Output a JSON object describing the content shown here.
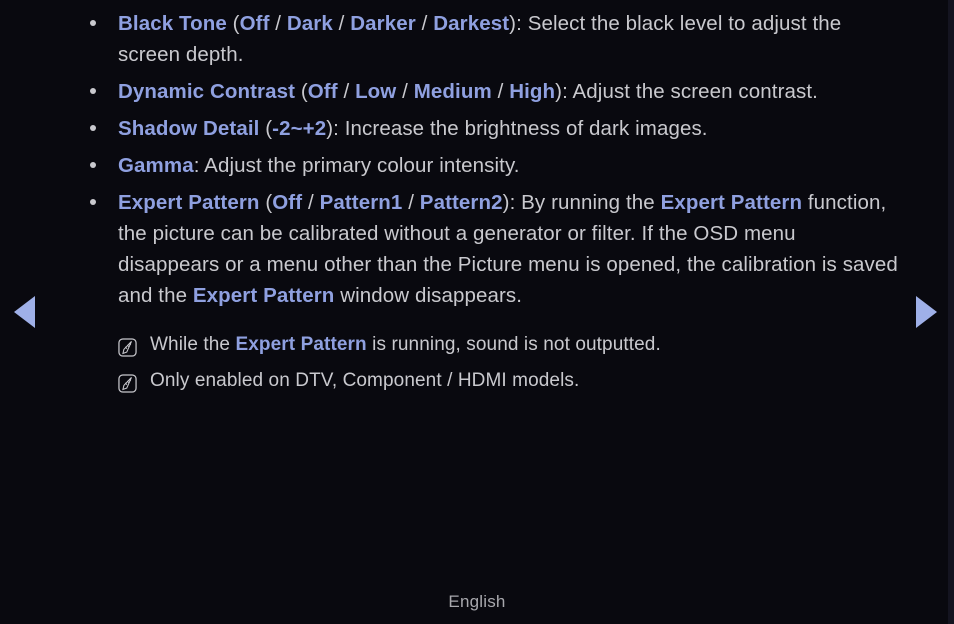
{
  "page": {
    "background_color": "#09090f",
    "text_color": "#c9c9ce",
    "accent_color": "#8fa0e0",
    "arrow_color": "#9fb0e8"
  },
  "bullets": [
    {
      "segments": [
        {
          "text": "Black Tone",
          "style": "keyword"
        },
        {
          "text": " (",
          "style": "plain"
        },
        {
          "text": "Off",
          "style": "keyword"
        },
        {
          "text": " / ",
          "style": "plain"
        },
        {
          "text": "Dark",
          "style": "keyword"
        },
        {
          "text": " / ",
          "style": "plain"
        },
        {
          "text": "Darker",
          "style": "keyword"
        },
        {
          "text": " / ",
          "style": "plain"
        },
        {
          "text": "Darkest",
          "style": "keyword"
        },
        {
          "text": "): Select the black level to adjust the screen depth.",
          "style": "plain"
        }
      ]
    },
    {
      "segments": [
        {
          "text": "Dynamic Contrast",
          "style": "keyword"
        },
        {
          "text": " (",
          "style": "plain"
        },
        {
          "text": "Off",
          "style": "keyword"
        },
        {
          "text": " / ",
          "style": "plain"
        },
        {
          "text": "Low",
          "style": "keyword"
        },
        {
          "text": " / ",
          "style": "plain"
        },
        {
          "text": "Medium",
          "style": "keyword"
        },
        {
          "text": " / ",
          "style": "plain"
        },
        {
          "text": "High",
          "style": "keyword"
        },
        {
          "text": "): Adjust the screen contrast.",
          "style": "plain"
        }
      ]
    },
    {
      "segments": [
        {
          "text": "Shadow Detail",
          "style": "keyword"
        },
        {
          "text": " (",
          "style": "plain"
        },
        {
          "text": "-2~+2",
          "style": "keyword"
        },
        {
          "text": "): Increase the brightness of dark images.",
          "style": "plain"
        }
      ]
    },
    {
      "segments": [
        {
          "text": "Gamma",
          "style": "keyword"
        },
        {
          "text": ": Adjust the primary colour intensity.",
          "style": "plain"
        }
      ]
    },
    {
      "segments": [
        {
          "text": "Expert Pattern",
          "style": "keyword"
        },
        {
          "text": " (",
          "style": "plain"
        },
        {
          "text": "Off",
          "style": "keyword"
        },
        {
          "text": " / ",
          "style": "plain"
        },
        {
          "text": "Pattern1",
          "style": "keyword"
        },
        {
          "text": " / ",
          "style": "plain"
        },
        {
          "text": "Pattern2",
          "style": "keyword"
        },
        {
          "text": "): By running the ",
          "style": "plain"
        },
        {
          "text": "Expert Pattern",
          "style": "keyword"
        },
        {
          "text": " function, the picture can be calibrated without a generator or filter. If the OSD menu disappears or a menu other than the Picture menu is opened, the calibration is saved and the ",
          "style": "plain"
        },
        {
          "text": "Expert Pattern",
          "style": "keyword"
        },
        {
          "text": " window disappears.",
          "style": "plain"
        }
      ]
    }
  ],
  "notes": [
    {
      "icon": "note-memo-icon",
      "segments": [
        {
          "text": "While the ",
          "style": "plain"
        },
        {
          "text": "Expert Pattern",
          "style": "keyword"
        },
        {
          "text": " is running, sound is not outputted.",
          "style": "plain"
        }
      ]
    },
    {
      "icon": "note-memo-icon",
      "segments": [
        {
          "text": "Only enabled on DTV, Component / HDMI models.",
          "style": "plain"
        }
      ]
    }
  ],
  "navigation": {
    "previous_label": "◀",
    "next_label": "▶"
  },
  "footer": {
    "language": "English"
  }
}
